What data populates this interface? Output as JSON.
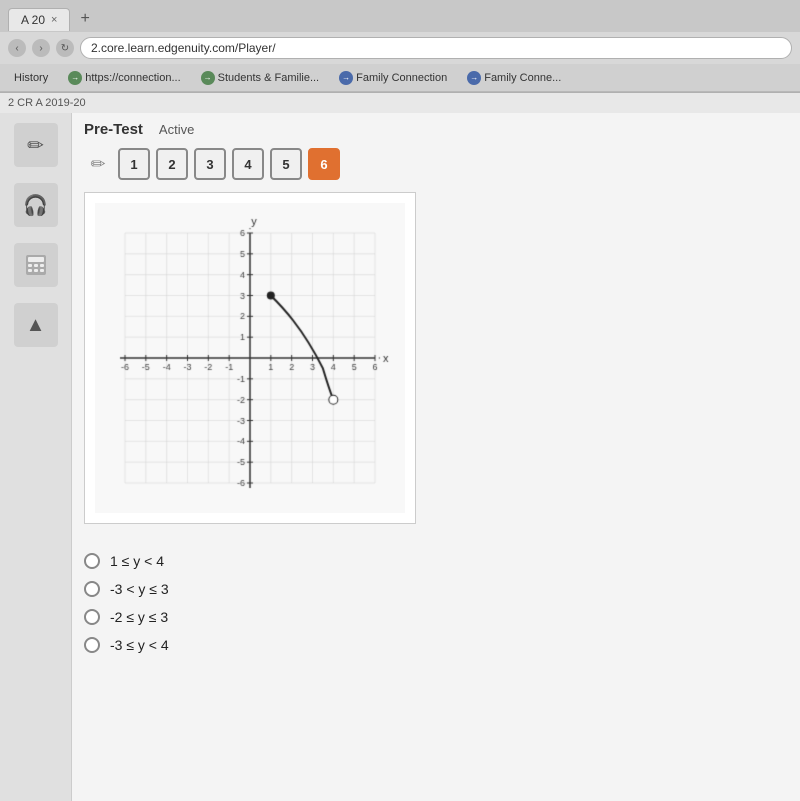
{
  "browser": {
    "tab_label": "A 20",
    "tab_close": "×",
    "tab_new": "+",
    "address": "2.core.learn.edgenuity.com/Player/",
    "bookmarks": [
      {
        "label": "History",
        "icon": "H",
        "icon_color": "gray"
      },
      {
        "label": "https://connection...",
        "icon": "→",
        "icon_color": "green"
      },
      {
        "label": "Students & Familie...",
        "icon": "→",
        "icon_color": "green"
      },
      {
        "label": "Family Connection",
        "icon": "→",
        "icon_color": "blue"
      },
      {
        "label": "Family Conne...",
        "icon": "→",
        "icon_color": "blue"
      }
    ]
  },
  "breadcrumb": "2 CR A 2019-20",
  "pretest": {
    "label": "Pre-Test",
    "status": "Active"
  },
  "questions": {
    "numbers": [
      "1",
      "2",
      "3",
      "4",
      "5",
      "6"
    ],
    "active_index": 5
  },
  "sidebar_icons": [
    {
      "name": "pencil",
      "symbol": "✏"
    },
    {
      "name": "headphones",
      "symbol": "🎧"
    },
    {
      "name": "calculator",
      "symbol": "⊞"
    },
    {
      "name": "arrow-up",
      "symbol": "▲"
    }
  ],
  "answer_choices": [
    {
      "id": "a",
      "text": "1 ≤ y < 4"
    },
    {
      "id": "b",
      "text": "-3 < y ≤ 3"
    },
    {
      "id": "c",
      "text": "-2 ≤ y ≤ 3"
    },
    {
      "id": "d",
      "text": "-3 ≤ y < 4"
    }
  ],
  "colors": {
    "active_btn": "#e07030",
    "accent": "#5a8a5a"
  }
}
